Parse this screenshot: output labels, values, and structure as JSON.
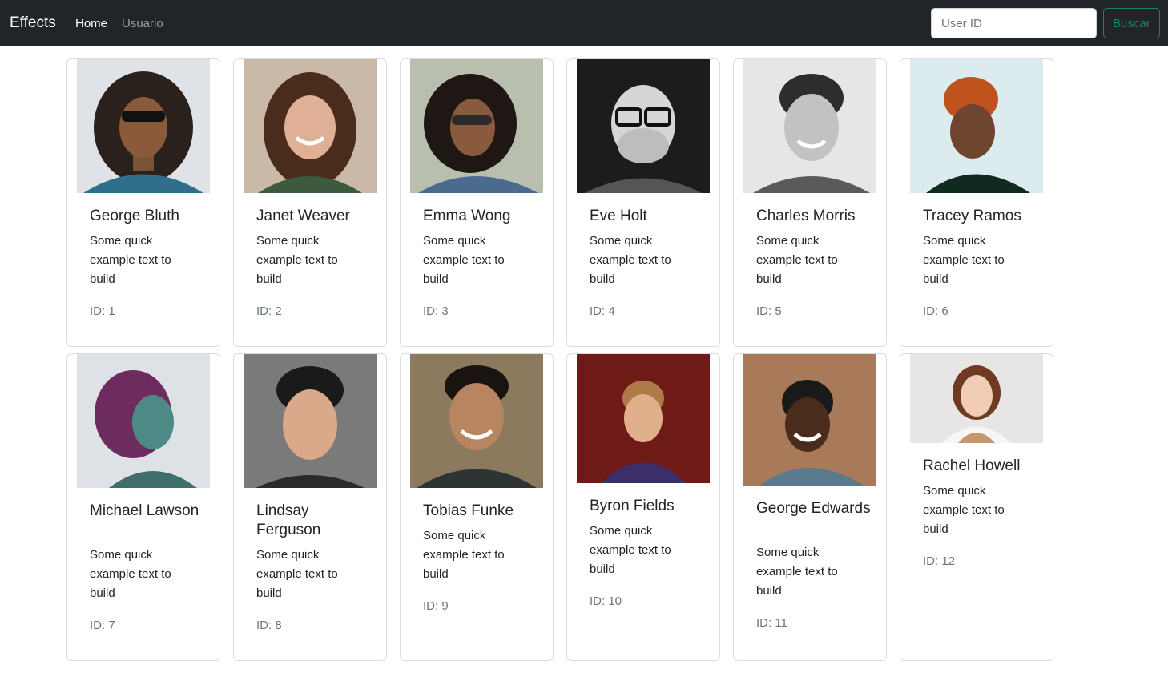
{
  "navbar": {
    "brand": "Effects",
    "links": [
      "Home",
      "Usuario"
    ],
    "search_placeholder": "User ID",
    "search_value": "",
    "search_button": "Buscar"
  },
  "cards": [
    {
      "name": "George Bluth",
      "text": "Some quick example text to build",
      "id_label": "ID: 1",
      "photo_icon": "person-photo-icon"
    },
    {
      "name": "Janet Weaver",
      "text": "Some quick example text to build",
      "id_label": "ID: 2",
      "photo_icon": "person-photo-icon"
    },
    {
      "name": "Emma Wong",
      "text": "Some quick example text to build",
      "id_label": "ID: 3",
      "photo_icon": "person-photo-icon"
    },
    {
      "name": "Eve Holt",
      "text": "Some quick example text to build",
      "id_label": "ID: 4",
      "photo_icon": "person-photo-icon"
    },
    {
      "name": "Charles Morris",
      "text": "Some quick example text to build",
      "id_label": "ID: 5",
      "photo_icon": "person-photo-icon"
    },
    {
      "name": "Tracey Ramos",
      "text": "Some quick example text to build",
      "id_label": "ID: 6",
      "photo_icon": "person-photo-icon"
    },
    {
      "name": "Michael Lawson",
      "text": "Some quick example text to build",
      "id_label": "ID: 7",
      "photo_icon": "person-photo-icon"
    },
    {
      "name": "Lindsay Ferguson",
      "text": "Some quick example text to build",
      "id_label": "ID: 8",
      "photo_icon": "person-photo-icon"
    },
    {
      "name": "Tobias Funke",
      "text": "Some quick example text to build",
      "id_label": "ID: 9",
      "photo_icon": "person-photo-icon"
    },
    {
      "name": "Byron Fields",
      "text": "Some quick example text to build",
      "id_label": "ID: 10",
      "photo_icon": "person-photo-icon"
    },
    {
      "name": "George Edwards",
      "text": "Some quick example text to build",
      "id_label": "ID: 11",
      "photo_icon": "person-photo-icon"
    },
    {
      "name": "Rachel Howell",
      "text": "Some quick example text to build",
      "id_label": "ID: 12",
      "photo_icon": "person-photo-icon"
    }
  ],
  "colors": {
    "navbar_bg": "#212529",
    "success": "#198754",
    "muted": "#6c757d"
  }
}
